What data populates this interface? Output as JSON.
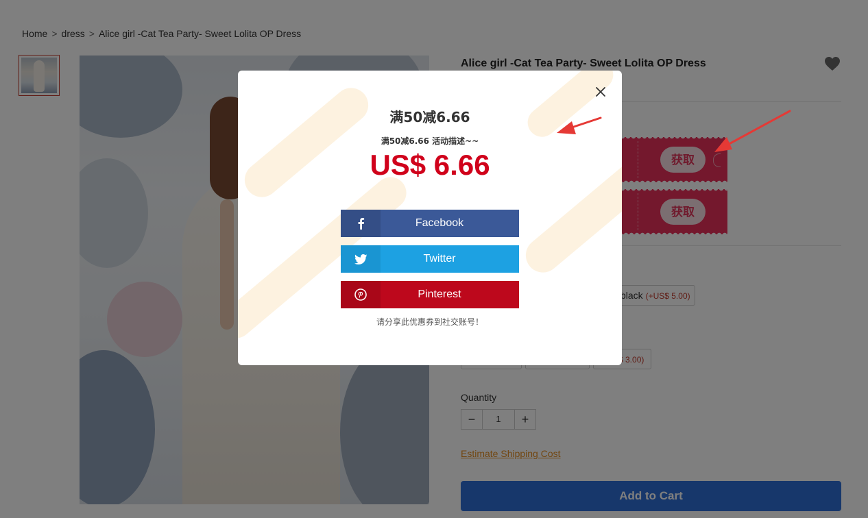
{
  "breadcrumb": {
    "home": "Home",
    "sep1": ">",
    "category": "dress",
    "sep2": ">",
    "current": "Alice girl -Cat Tea Party- Sweet Lolita OP Dress"
  },
  "product": {
    "title": "Alice girl -Cat Tea Party- Sweet Lolita OP Dress",
    "coupons": [
      {
        "get_label": "获取"
      },
      {
        "get_label": "获取"
      }
    ],
    "color_option": {
      "name": "black",
      "extra": "(+US$ 5.00)"
    },
    "size_option_extra": "$ 3.00)",
    "quantity_label": "Quantity",
    "quantity_value": "1",
    "qty_minus": "−",
    "qty_plus": "+",
    "shipping_link": "Estimate Shipping Cost",
    "add_to_cart": "Add to Cart"
  },
  "modal": {
    "title": "满50减6.66",
    "description": "满50减6.66 活动描述~~",
    "price": "US$ 6.66",
    "share_buttons": [
      {
        "label": "Facebook",
        "icon": "facebook-icon",
        "color": "#3b5998"
      },
      {
        "label": "Twitter",
        "icon": "twitter-icon",
        "color": "#1da1e2"
      },
      {
        "label": "Pinterest",
        "icon": "pinterest-icon",
        "color": "#bd081c"
      }
    ],
    "note": "请分享此优惠券到社交账号！"
  },
  "colors": {
    "price_red": "#d0021b",
    "coupon_pink": "#e8315b",
    "cart_blue": "#2f6fd6",
    "link_orange": "#e58c1f"
  }
}
